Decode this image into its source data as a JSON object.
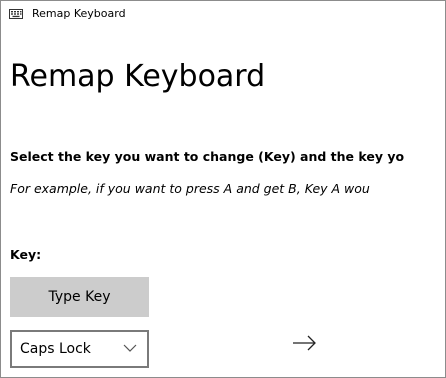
{
  "window": {
    "title": "Remap Keyboard",
    "icon": "keyboard-icon"
  },
  "page": {
    "title": "Remap Keyboard",
    "instruction": "Select the key you want to change (Key) and the key yo",
    "example": "For example, if you want to press A and get B, Key A wou"
  },
  "key_section": {
    "label": "Key:",
    "type_key_button": "Type Key",
    "dropdown_value": "Caps Lock",
    "dropdown_icon": "chevron-down-icon",
    "arrow_icon": "right-arrow-icon"
  }
}
